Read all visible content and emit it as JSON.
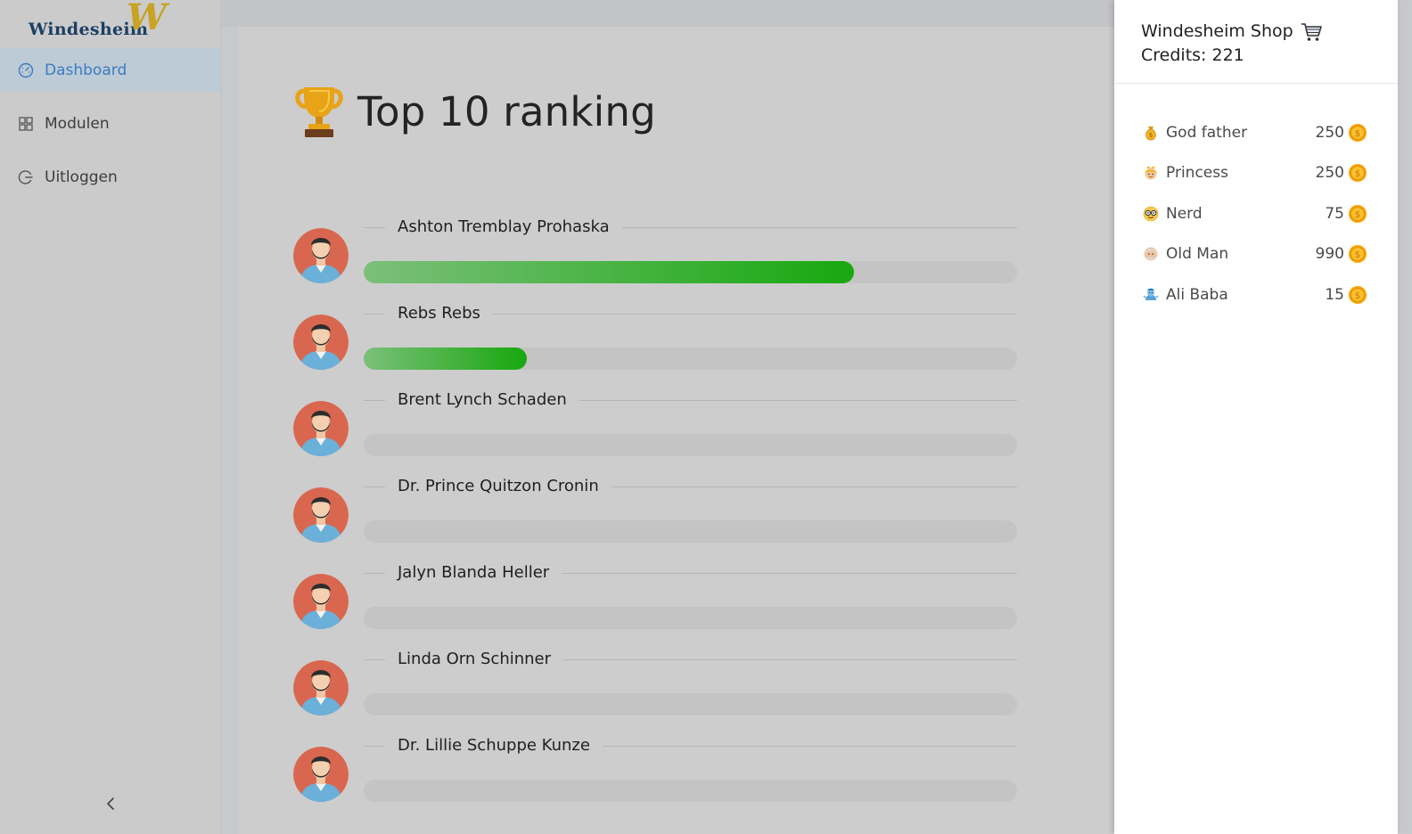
{
  "app": {
    "logo_text": "Windesheim",
    "logo_mark": "W"
  },
  "sidebar": {
    "items": [
      {
        "label": "Dashboard",
        "icon": "speedometer-icon",
        "active": true
      },
      {
        "label": "Modulen",
        "icon": "grid-icon",
        "active": false
      },
      {
        "label": "Uitloggen",
        "icon": "logout-icon",
        "active": false
      }
    ],
    "collapse_icon": "chevron-left-icon"
  },
  "main": {
    "title": "Top 10 ranking",
    "title_icon": "trophy-icon",
    "ranking": [
      {
        "name": "Ashton Tremblay Prohaska",
        "progress": 0.75
      },
      {
        "name": "Rebs Rebs",
        "progress": 0.25
      },
      {
        "name": "Brent Lynch Schaden",
        "progress": 0
      },
      {
        "name": "Dr. Prince Quitzon Cronin",
        "progress": 0
      },
      {
        "name": "Jalyn Blanda Heller",
        "progress": 0
      },
      {
        "name": "Linda Orn Schinner",
        "progress": 0
      },
      {
        "name": "Dr. Lillie Schuppe Kunze",
        "progress": 0
      }
    ],
    "progress_color_start": "#7cbf7a",
    "progress_color_end": "#17a80f"
  },
  "shop": {
    "title": "Windesheim Shop",
    "cart_icon": "shopping-cart-icon",
    "credits_label": "Credits: 221",
    "items": [
      {
        "name": "God father",
        "price": "250",
        "icon": "money-bag-emoji-icon"
      },
      {
        "name": "Princess",
        "price": "250",
        "icon": "princess-emoji-icon"
      },
      {
        "name": "Nerd",
        "price": "75",
        "icon": "nerd-emoji-icon"
      },
      {
        "name": "Old Man",
        "price": "990",
        "icon": "old-man-emoji-icon"
      },
      {
        "name": "Ali Baba",
        "price": "15",
        "icon": "genie-emoji-icon"
      }
    ],
    "coin_icon": "gold-coin-icon"
  }
}
